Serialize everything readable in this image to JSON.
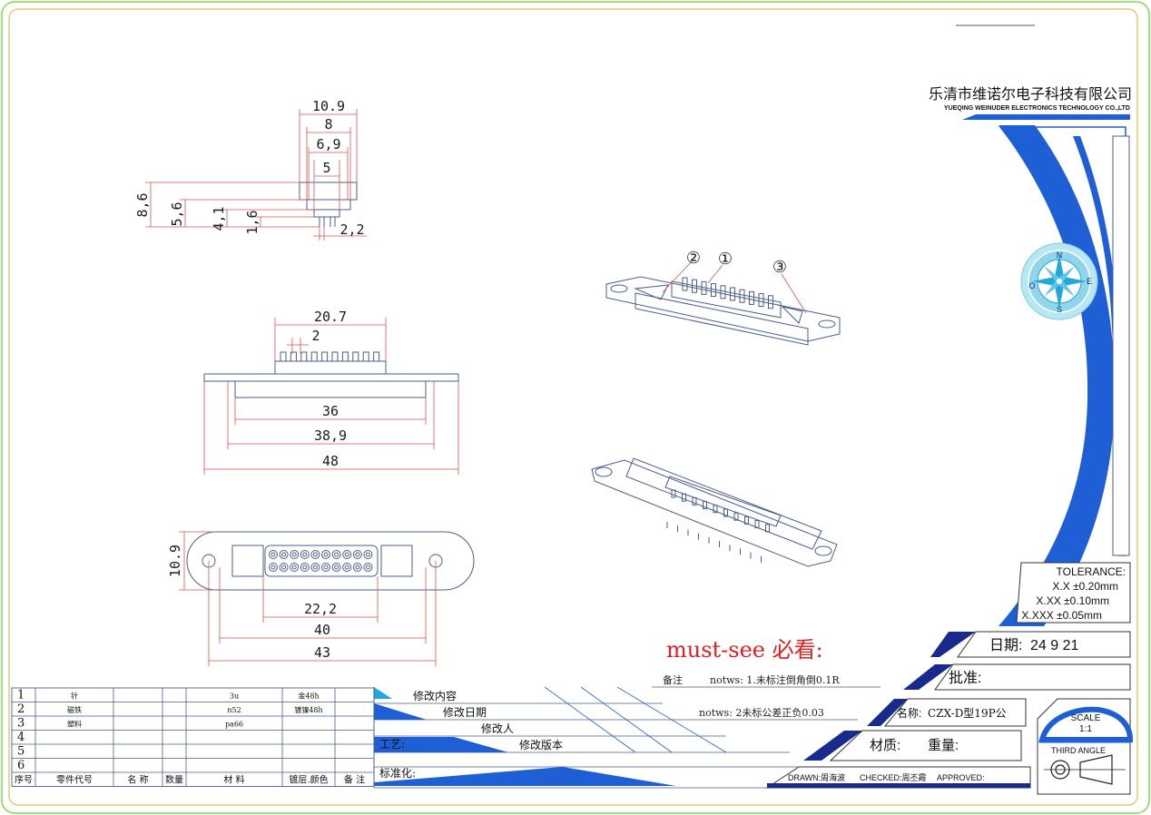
{
  "colors": {
    "outer_border": "#7ed957",
    "inner_border": "#e8c873",
    "line": "#4a5d8c",
    "dim": "#d9534f",
    "blue": "#1f5fd6",
    "darkblue": "#1a2a8c",
    "red": "#e02020",
    "cyan": "#20a8d8"
  },
  "company": {
    "name_cn": "乐清市维诺尔电子科技有限公司",
    "name_en": "YUEQING WEINUDER ELECTRONICS TECHNOLOGY CO.,LTD"
  },
  "compass": {
    "n": "N",
    "e": "E",
    "s": "S",
    "w": "O"
  },
  "tolerance": {
    "title": "TOLERANCE:",
    "l1": "X.X  ±0.20mm",
    "l2": "X.XX  ±0.10mm",
    "l3": "X.XXX  ±0.05mm"
  },
  "date": {
    "label": "日期:",
    "value": "24 9 21"
  },
  "approve": {
    "label": "批准:"
  },
  "name": {
    "label": "名称:",
    "value": "CZX-D型19P公"
  },
  "material": {
    "label": "材质:",
    "weight": "重量:"
  },
  "scale": {
    "label": "SCALE",
    "value": "1:1",
    "angle": "THIRD ANGLE"
  },
  "drawn": {
    "drawn": "DRAWN:周海波",
    "checked": "CHECKED:周丕霞",
    "approved": "APPROVED:"
  },
  "mustsee": "must-see 必看:",
  "notes": {
    "label": "备注",
    "n1": "notws: 1.未标注倒角倒0.1R",
    "n2": "notws: 2未标公差正负0.03"
  },
  "revision": {
    "content": "修改内容",
    "date": "修改日期",
    "person": "修改人",
    "version": "修改版本",
    "process": "工艺:",
    "standard": "标准化:"
  },
  "bom": {
    "headers": [
      "序号",
      "零件代号",
      "名 称",
      "数量",
      "材  料",
      "镀层.颜色",
      "备 注"
    ],
    "rows": [
      {
        "no": "1",
        "code": "针",
        "name": "",
        "qty": "",
        "mat": "3u",
        "plating": "金48h",
        "note": ""
      },
      {
        "no": "2",
        "code": "磁铁",
        "name": "",
        "qty": "",
        "mat": "n52",
        "plating": "镀镍48h",
        "note": ""
      },
      {
        "no": "3",
        "code": "塑料",
        "name": "",
        "qty": "",
        "mat": "pa66",
        "plating": "",
        "note": ""
      },
      {
        "no": "4",
        "code": "",
        "name": "",
        "qty": "",
        "mat": "",
        "plating": "",
        "note": ""
      },
      {
        "no": "5",
        "code": "",
        "name": "",
        "qty": "",
        "mat": "",
        "plating": "",
        "note": ""
      },
      {
        "no": "6",
        "code": "",
        "name": "",
        "qty": "",
        "mat": "",
        "plating": "",
        "note": ""
      }
    ]
  },
  "side_dims": {
    "w1": "10.9",
    "w2": "8",
    "w3": "6,9",
    "w4": "5",
    "h1": "8,6",
    "h2": "5,6",
    "h3": "4,1",
    "h4": "1,6",
    "pin": "2,2"
  },
  "front_dims": {
    "top": "20.7",
    "pitch": "2",
    "d1": "36",
    "d2": "38,9",
    "d3": "48"
  },
  "bottom_dims": {
    "h": "10.9",
    "d1": "22,2",
    "d2": "40",
    "d3": "43"
  },
  "callouts": {
    "c1": "①",
    "c2": "②",
    "c3": "③"
  }
}
